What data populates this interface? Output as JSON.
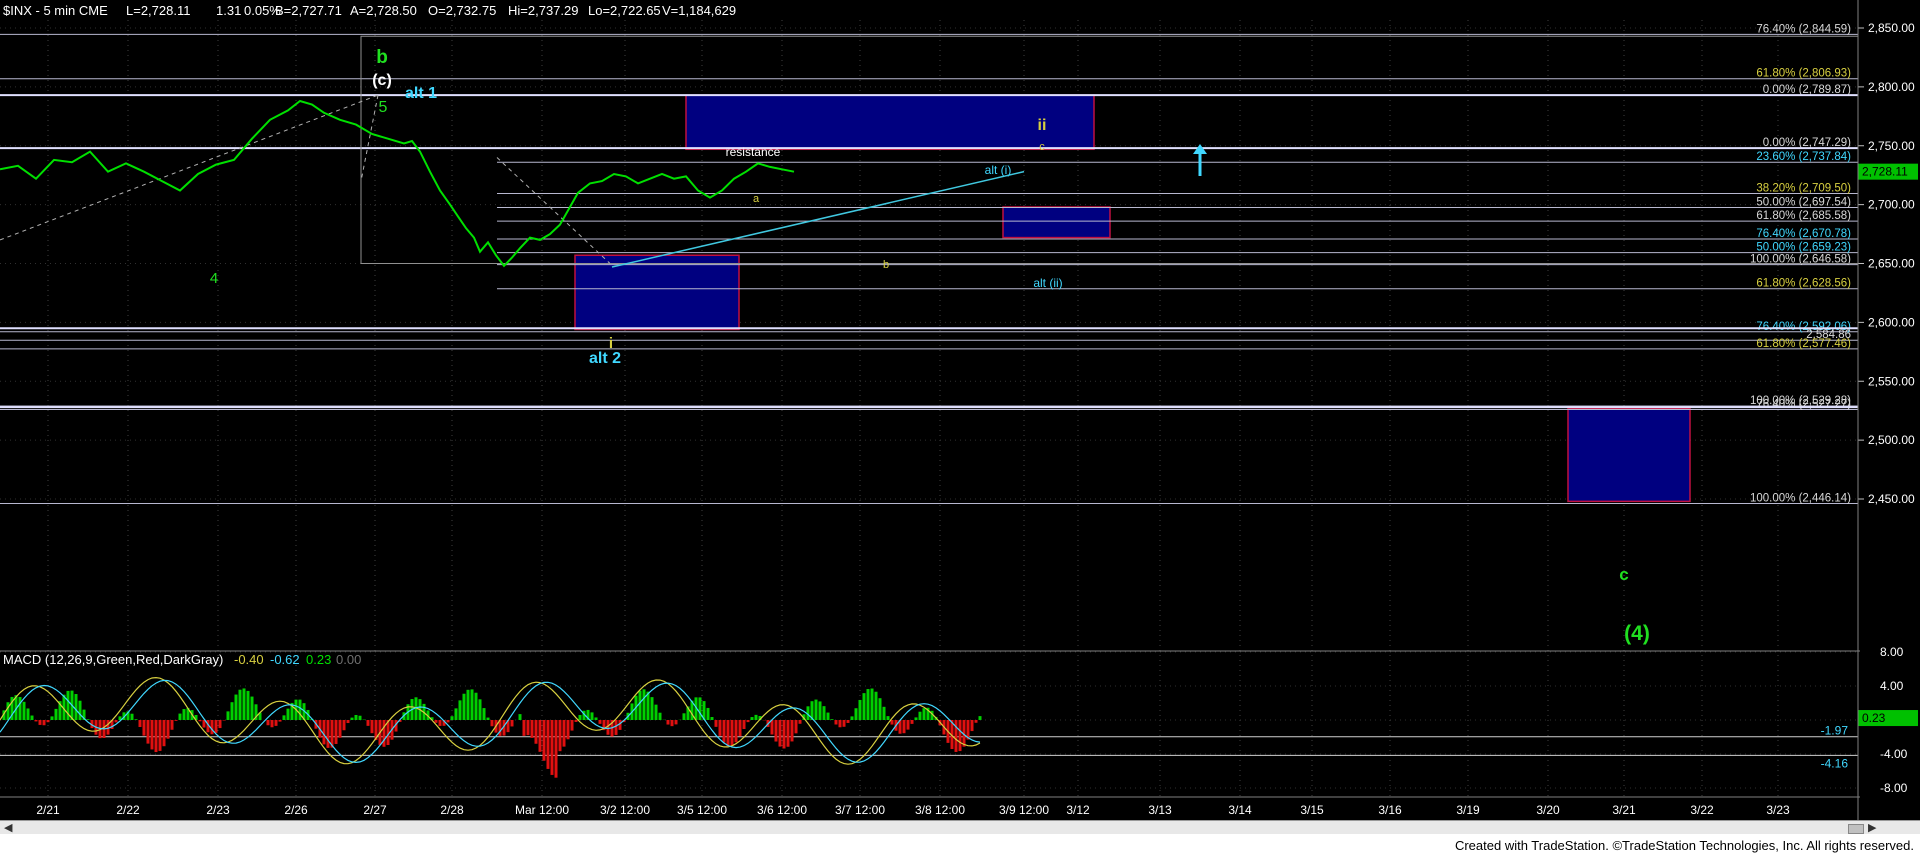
{
  "header": {
    "symbol": "$INX - 5 min  CME",
    "last": "L=2,728.11",
    "change": "1.31",
    "pct": "0.05%",
    "bid": "B=2,727.71",
    "ask": "A=2,728.50",
    "open": "O=2,732.75",
    "high": "Hi=2,737.29",
    "low": "Lo=2,722.65",
    "volume": "V=1,184,629"
  },
  "macd_header": {
    "label": "MACD (12,26,9,Green,Red,DarkGray)",
    "v1": "-0.40",
    "v2": "-0.62",
    "v3": "0.23",
    "v4": "0.00"
  },
  "colors": {
    "background": "#000000",
    "price": "#00e000",
    "label_yellow": "#d8d040",
    "label_cyan": "#40d8ff",
    "label_green": "#20e020",
    "box_fill": "#000080",
    "box_border": "#c01040",
    "fib_line": "#b0b0c8"
  },
  "chart_data": {
    "type": "line",
    "title": "$INX - 5 min",
    "x_ticks": [
      "2/21",
      "2/22",
      "2/23",
      "2/26",
      "2/27",
      "2/28",
      "Mar 12:00",
      "3/2 12:00",
      "3/5 12:00",
      "3/6 12:00",
      "3/7 12:00",
      "3/8 12:00",
      "3/9 12:00",
      "3/12",
      "3/13",
      "3/14",
      "3/15",
      "3/16",
      "3/19",
      "3/20",
      "3/21",
      "3/22",
      "3/23"
    ],
    "y_ticks": [
      "2,850.00",
      "2,800.00",
      "2,750.00",
      "2,700.00",
      "2,650.00",
      "2,600.00",
      "2,550.00",
      "2,500.00",
      "2,450.00"
    ],
    "ylim": [
      2425,
      2870
    ],
    "last_price": "2,728.11",
    "series": [
      {
        "values": [
          [
            0,
            2730
          ],
          [
            18,
            2733
          ],
          [
            36,
            2722
          ],
          [
            54,
            2738
          ],
          [
            72,
            2736
          ],
          [
            90,
            2745
          ],
          [
            108,
            2728
          ],
          [
            126,
            2735
          ],
          [
            144,
            2728
          ],
          [
            162,
            2720
          ],
          [
            180,
            2712
          ],
          [
            198,
            2726
          ],
          [
            216,
            2734
          ],
          [
            234,
            2738
          ],
          [
            252,
            2756
          ],
          [
            270,
            2772
          ],
          [
            288,
            2780
          ],
          [
            300,
            2788
          ],
          [
            312,
            2785
          ],
          [
            324,
            2778
          ],
          [
            340,
            2772
          ],
          [
            356,
            2768
          ],
          [
            372,
            2760
          ],
          [
            388,
            2756
          ],
          [
            404,
            2752
          ],
          [
            412,
            2754
          ],
          [
            420,
            2745
          ],
          [
            430,
            2728
          ],
          [
            440,
            2712
          ],
          [
            450,
            2700
          ],
          [
            458,
            2690
          ],
          [
            466,
            2680
          ],
          [
            474,
            2672
          ],
          [
            480,
            2660
          ],
          [
            488,
            2668
          ],
          [
            496,
            2657
          ],
          [
            504,
            2648
          ],
          [
            512,
            2655
          ],
          [
            520,
            2663
          ],
          [
            530,
            2672
          ],
          [
            540,
            2670
          ],
          [
            550,
            2675
          ],
          [
            560,
            2683
          ],
          [
            568,
            2695
          ],
          [
            578,
            2710
          ],
          [
            590,
            2718
          ],
          [
            602,
            2720
          ],
          [
            614,
            2726
          ],
          [
            626,
            2724
          ],
          [
            638,
            2718
          ],
          [
            650,
            2722
          ],
          [
            662,
            2726
          ],
          [
            674,
            2722
          ],
          [
            686,
            2724
          ],
          [
            698,
            2712
          ],
          [
            710,
            2706
          ],
          [
            722,
            2712
          ],
          [
            734,
            2722
          ],
          [
            746,
            2728
          ],
          [
            758,
            2735
          ],
          [
            770,
            2732
          ],
          [
            782,
            2730
          ],
          [
            794,
            2728
          ]
        ]
      }
    ],
    "fib_levels": [
      {
        "text": "76.40% (2,844.59)",
        "value": 2844.59
      },
      {
        "text": "61.80% (2,806.93)",
        "value": 2806.93
      },
      {
        "text": "0.00% (2,789.87)",
        "value": 2793
      },
      {
        "text": "0.00% (2,747.29)",
        "value": 2748
      },
      {
        "text": "23.60% (2,737.84)",
        "value": 2736
      },
      {
        "text": "38.20% (2,709.50)",
        "value": 2709.5
      },
      {
        "text": "50.00% (2,697.54)",
        "value": 2697.54
      },
      {
        "text": "61.80% (2,685.58)",
        "value": 2686
      },
      {
        "text": "76.40% (2,670.78)",
        "value": 2670.78
      },
      {
        "text": "50.00% (2,659.23)",
        "value": 2659.23
      },
      {
        "text": "100.00% (2,646.58)",
        "value": 2649
      },
      {
        "text": "61.80% (2,628.56)",
        "value": 2628.56
      },
      {
        "text": "76.40% (2,592.06)",
        "value": 2592
      },
      {
        "text": "2,584.86",
        "value": 2584.86
      },
      {
        "text": "61.80% (2,577.46)",
        "value": 2577.46
      },
      {
        "text": "100.00% (2,529.28)",
        "value": 2529
      },
      {
        "text": "76.40% (2,527.27)",
        "value": 2526
      },
      {
        "text": "100.00% (2,446.14)",
        "value": 2446.14
      }
    ],
    "wave_labels": [
      "b",
      "(c)",
      "5",
      "alt 1",
      "4",
      "alt 2",
      "i",
      "a",
      "b",
      "ii",
      "c",
      "alt (i)",
      "alt (ii)",
      "resistance",
      "c",
      "(4)"
    ],
    "macd": {
      "y_ticks": [
        "8.00",
        "4.00",
        "0.00",
        "-4.00",
        "-8.00"
      ],
      "readouts": [
        "0.23",
        "-1.97",
        "-4.16"
      ]
    }
  },
  "footer": {
    "credit": "Created with TradeStation. ©TradeStation Technologies, Inc. All rights reserved."
  },
  "scrollbar": {
    "left": "◀",
    "right": "▶"
  }
}
